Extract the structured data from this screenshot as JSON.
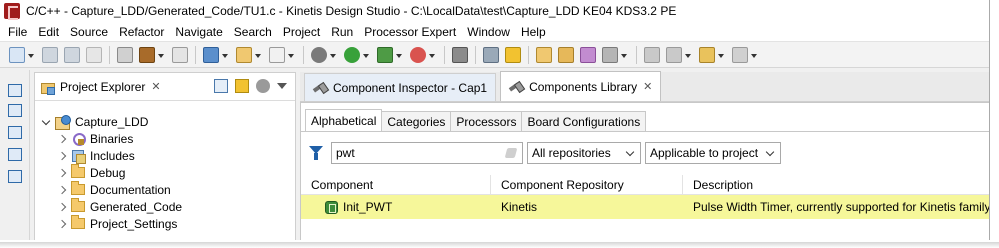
{
  "window": {
    "title": "C/C++ - Capture_LDD/Generated_Code/TU1.c - Kinetis Design Studio - C:\\LocalData\\test\\Capture_LDD KE04 KDS3.2 PE"
  },
  "menu": [
    {
      "label": "File"
    },
    {
      "label": "Edit"
    },
    {
      "label": "Source"
    },
    {
      "label": "Refactor"
    },
    {
      "label": "Navigate"
    },
    {
      "label": "Search"
    },
    {
      "label": "Project"
    },
    {
      "label": "Run"
    },
    {
      "label": "Processor Expert"
    },
    {
      "label": "Window"
    },
    {
      "label": "Help"
    }
  ],
  "colors": {
    "highlight_row": "#f6f79a",
    "accent_blue": "#1f5fa7",
    "component_green": "#3e8d3a"
  },
  "project_explorer": {
    "title": "Project Explorer",
    "close": "✕",
    "tree": [
      {
        "label": "Capture_LDD",
        "icon": "project-icon",
        "expanded": true,
        "level": 0
      },
      {
        "label": "Binaries",
        "icon": "binaries-icon",
        "level": 1
      },
      {
        "label": "Includes",
        "icon": "includes-icon",
        "level": 1
      },
      {
        "label": "Debug",
        "icon": "folder-icon",
        "level": 1
      },
      {
        "label": "Documentation",
        "icon": "folder-icon",
        "level": 1
      },
      {
        "label": "Generated_Code",
        "icon": "folder-icon",
        "level": 1
      },
      {
        "label": "Project_Settings",
        "icon": "folder-icon",
        "level": 1
      }
    ]
  },
  "editor_tabs": [
    {
      "label": "Component Inspector - Cap1",
      "active": false
    },
    {
      "label": "Components Library",
      "active": true,
      "close": "✕"
    }
  ],
  "library": {
    "subtabs": [
      {
        "label": "Alphabetical",
        "active": true
      },
      {
        "label": "Categories",
        "active": false
      },
      {
        "label": "Processors",
        "active": false
      },
      {
        "label": "Board Configurations",
        "active": false
      }
    ],
    "search_value": "pwt",
    "repository_select": "All repositories",
    "applicability_select": "Applicable to project",
    "columns": [
      "Component",
      "Component Repository",
      "Description"
    ],
    "rows": [
      {
        "component": "Init_PWT",
        "repository": "Kinetis",
        "description": "Pulse Width Timer, currently supported for Kinetis family"
      }
    ]
  }
}
